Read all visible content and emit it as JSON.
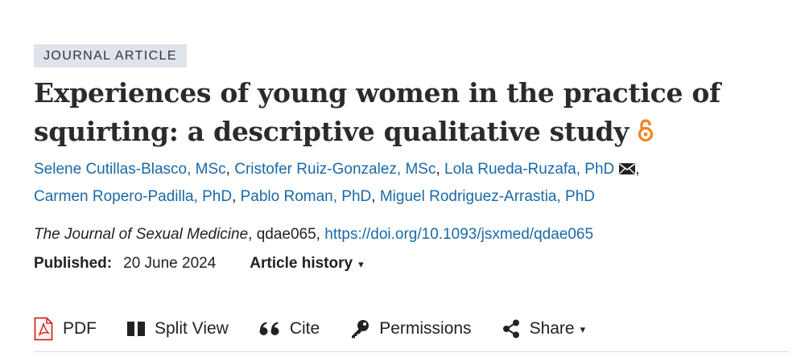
{
  "article": {
    "type_badge": "JOURNAL ARTICLE",
    "title_line1": "Experiences of young women in the practice of",
    "title_line2": "squirting: a descriptive qualitative study",
    "authors": [
      "Selene Cutillas-Blasco, MSc",
      "Cristofer Ruiz-Gonzalez, MSc",
      "Lola Rueda-Ruzafa, PhD",
      "Carmen Ropero-Padilla, PhD",
      "Pablo Roman, PhD",
      "Miguel Rodriguez-Arrastia, PhD"
    ],
    "author_separator": ",",
    "journal": "The Journal of Sexual Medicine",
    "article_id": ", qdae065, ",
    "doi": "https://doi.org/10.1093/jsxmed/qdae065",
    "published_label": "Published:",
    "published_date": "20 June 2024",
    "history_label": "Article history",
    "history_caret": "▾"
  },
  "toolbar": {
    "pdf_label": "PDF",
    "split_view_label": "Split View",
    "cite_label": "Cite",
    "permissions_label": "Permissions",
    "share_label": "Share",
    "share_caret": "▾"
  },
  "colors": {
    "link": "#1a69a8",
    "open_access": "#f58220",
    "pdf_red": "#d7261e",
    "badge_bg": "#dfe3ea"
  },
  "icons": {
    "open_access": "open-access-lock-icon",
    "email": "envelope-icon",
    "pdf": "pdf-file-icon",
    "split_view": "split-view-icon",
    "cite": "quote-icon",
    "permissions": "key-icon",
    "share": "share-icon"
  }
}
